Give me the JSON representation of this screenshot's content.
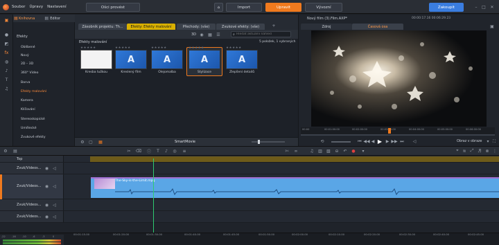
{
  "menu": [
    "Soubor",
    "Úpravy",
    "Nastavení"
  ],
  "top_buttons": {
    "open_simple": "Ošci provést",
    "home_icon": "home-icon",
    "import": "Import",
    "edit": "Upravit",
    "export": "Vývozní",
    "buy": "Zakoupit"
  },
  "colors": {
    "accent": "#f07a1e",
    "buy": "#3a7de0",
    "gold_tab": "#d9b000",
    "audio_clip": "#5aa6e6",
    "playhead": "#2ecc71"
  },
  "library": {
    "tab_library": "Knihovna",
    "tab_editor": "Editor",
    "category_header": "Efekty"
  },
  "categories": [
    "Oblíbené",
    "Nový",
    "2D – 3D",
    "360° Video",
    "Barva",
    "Efekty malování",
    "Kamera",
    "Klíčování",
    "Stereoskopické",
    "Umělecké",
    "Zvukové efekty"
  ],
  "content_tabs": [
    "Zásobník projektu: Th...",
    "Efekty: Efekty malování",
    "Přechody: (vše)",
    "Zvukové efekty: (vše)"
  ],
  "search": {
    "placeholder": "Hledat aktuální náhled"
  },
  "effects_panel": {
    "title": "Efekty malování",
    "count": "5 položek, 1 vybraných",
    "footer": "SmartMovie",
    "mode_3d": "3D"
  },
  "effects": [
    {
      "label": "Kresba tužkou",
      "letter": ""
    },
    {
      "label": "Kreslený film",
      "letter": "A"
    },
    {
      "label": "Olejomalba",
      "letter": "A"
    },
    {
      "label": "Stylizace",
      "letter": "A"
    },
    {
      "label": "Zlepšení detailů",
      "letter": "A"
    }
  ],
  "preview": {
    "title": "Nový film (3).Film.AXP*",
    "timecode": "00:00:17.16 00:06:29.23",
    "tab_source": "Zdroj",
    "tab_timeline": "Časová osa",
    "zoom_label": "Obraz v obraze",
    "ruler": [
      "00:00",
      "00:01:00:00",
      "00:02:00:00",
      "00:03:00:00",
      "00:04:00:00",
      "00:05:00:00",
      "00:06:00:00"
    ]
  },
  "tracks": [
    {
      "name": "Top"
    },
    {
      "name": "Zvuk/Videos..."
    },
    {
      "name": "Zvuk/Videos..."
    },
    {
      "name": "Zvuk/Videos..."
    },
    {
      "name": "Zvuk/Videos..."
    }
  ],
  "clip": {
    "title": "The-Sky-is-the-Limit.mpg"
  },
  "timeline_ticks": [
    "00:01:15.00",
    "00:01:20.00",
    "00:01:30.00",
    "00:01:40.00",
    "00:01:45.00",
    "00:01:50.00",
    "00:02:00.00",
    "00:02:10.00",
    "00:02:20.00",
    "00:02:30.00",
    "00:02:40.00",
    "00:02:45.00"
  ],
  "meter_labels": [
    "-22",
    "-16",
    "-10",
    "-6",
    "-3",
    "0"
  ]
}
